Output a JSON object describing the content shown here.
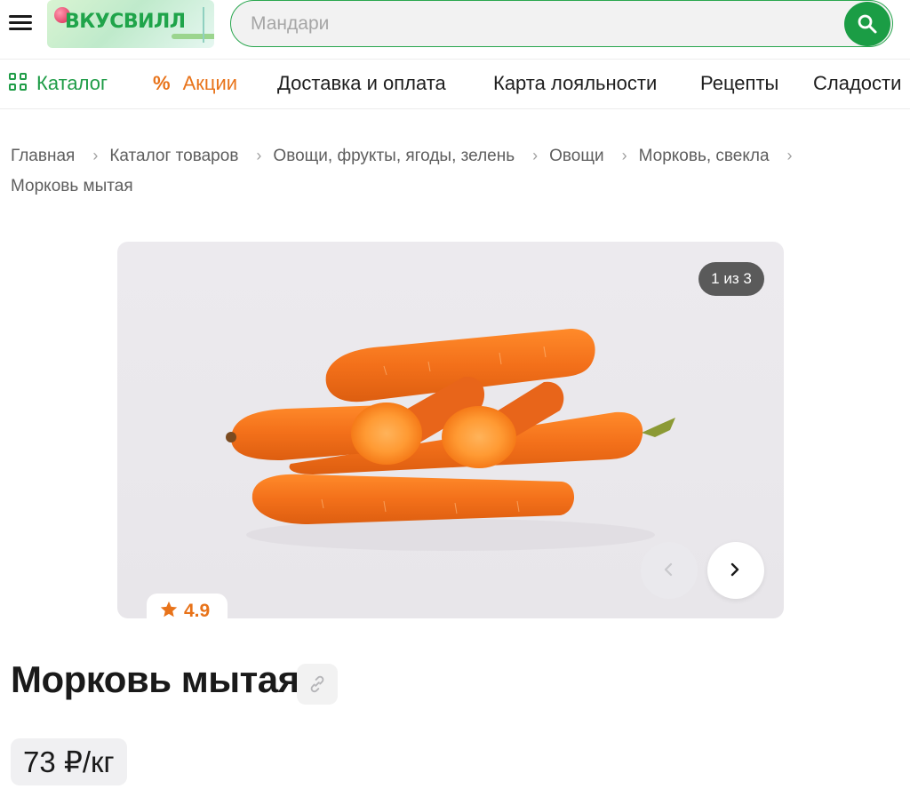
{
  "header": {
    "menu_icon": "hamburger-icon",
    "logo_text": "ВКУСВИЛЛ",
    "search_placeholder": "Мандари",
    "search_icon": "search-icon",
    "accent": "#1b9d45"
  },
  "nav": {
    "catalog": "Каталог",
    "promo": "Акции",
    "promo_symbol": "%",
    "delivery": "Доставка и оплата",
    "loyalty": "Карта лояльности",
    "recipes": "Рецепты",
    "sweets": "Сладости",
    "promo_color": "#e8731a"
  },
  "breadcrumb": {
    "items": [
      "Главная",
      "Каталог товаров",
      "Овощи, фрукты, ягоды, зелень",
      "Овощи",
      "Морковь, свекла"
    ],
    "current": "Морковь мытая"
  },
  "gallery": {
    "counter": "1 из 3",
    "rating": "4.9"
  },
  "product": {
    "title": "Морковь мытая",
    "price": "73 ₽/кг"
  }
}
